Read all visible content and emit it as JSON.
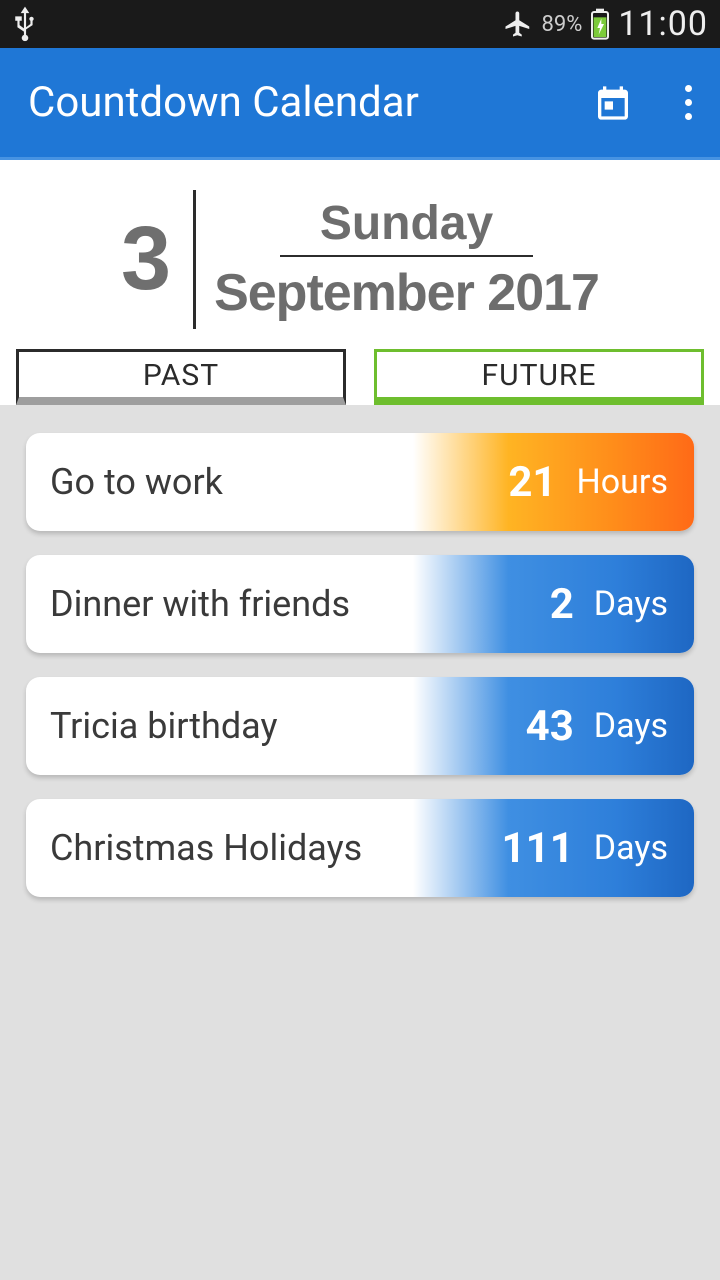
{
  "status": {
    "battery_pct": "89%",
    "time": "11:00"
  },
  "app": {
    "title": "Countdown Calendar"
  },
  "date": {
    "day_num": "3",
    "weekday": "Sunday",
    "month_year": "September 2017"
  },
  "tabs": {
    "past": "PAST",
    "future": "FUTURE",
    "active": "future"
  },
  "events": [
    {
      "title": "Go to work",
      "count": "21",
      "unit": "Hours",
      "accent": "orange"
    },
    {
      "title": "Dinner with friends",
      "count": "2",
      "unit": "Days",
      "accent": "blue"
    },
    {
      "title": "Tricia birthday",
      "count": "43",
      "unit": "Days",
      "accent": "blue"
    },
    {
      "title": "Christmas Holidays",
      "count": "111",
      "unit": "Days",
      "accent": "blue"
    }
  ]
}
